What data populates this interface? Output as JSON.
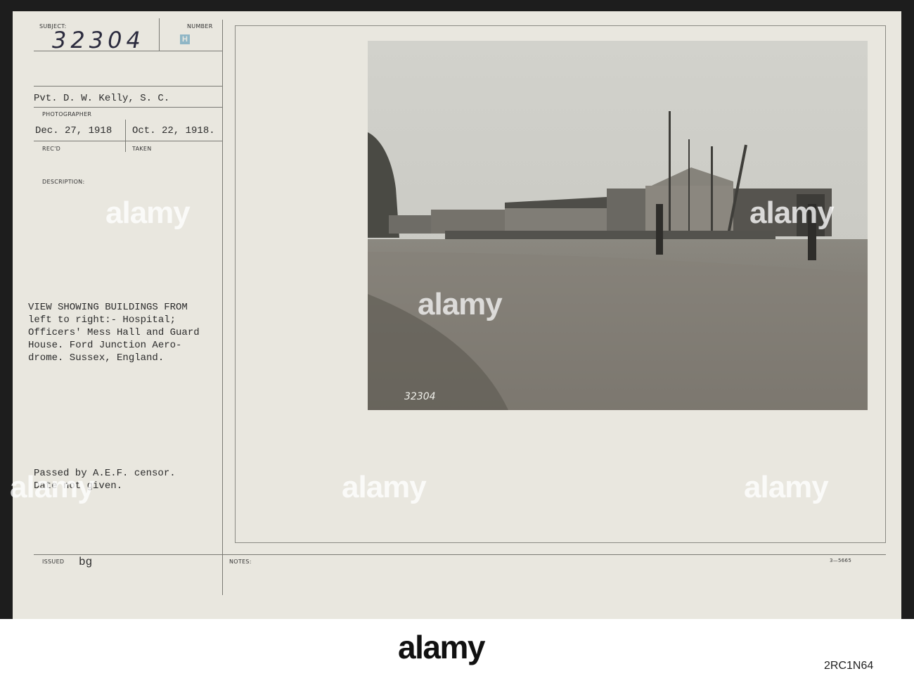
{
  "labels": {
    "subject": "SUBJECT:",
    "number": "NUMBER",
    "photographer": "PHOTOGRAPHER",
    "recd": "REC'D",
    "taken": "TAKEN",
    "description": "DESCRIPTION:",
    "issued": "ISSUED",
    "notes": "NOTES:"
  },
  "record": {
    "subject_number": "32304",
    "number_stamp": "H",
    "photographer": "Pvt. D. W. Kelly, S. C.",
    "recd_date": "Dec. 27, 1918",
    "taken_date": "Oct. 22, 1918.",
    "description_lines": [
      "VIEW SHOWING BUILDINGS FROM",
      "left to right:- Hospital;",
      "Officers' Mess Hall and Guard",
      "House.  Ford Junction Aero-",
      "drome. Sussex, England."
    ],
    "censor_lines": [
      "Passed by A.E.F. censor.",
      "Date not given."
    ],
    "issued_by": "bg",
    "form_code": "3—5665",
    "photo_caption_number": "32304"
  },
  "watermark": {
    "text": "alamy"
  },
  "footer": {
    "logo": "alamy",
    "image_id": "2RC1N64"
  }
}
